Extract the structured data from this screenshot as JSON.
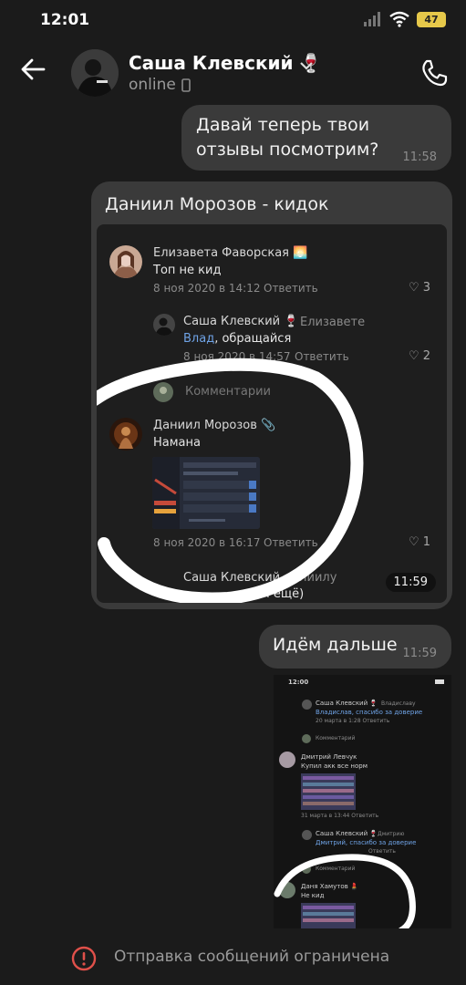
{
  "status": {
    "time": "12:01",
    "battery": "47"
  },
  "header": {
    "contact_name": "Саша Клевский 🍷",
    "status": "online"
  },
  "messages": {
    "m1": {
      "text": "Давай теперь твои отзывы посмотрим?",
      "time": "11:58"
    },
    "forward": {
      "title": "Даниил Морозов - кидок",
      "time": "11:59",
      "comments": [
        {
          "author": "Елизавета Фаворская 🌅",
          "text": "Топ не кид",
          "date": "8 ноя 2020 в 14:12",
          "reply": "Ответить",
          "likes": "3"
        },
        {
          "author": "Саша Клевский 🍷",
          "to": "Елизавете",
          "link": "Влад",
          "text": ", обращайся",
          "date": "8 ноя 2020 в 14:57",
          "reply": "Ответить",
          "likes": "2"
        },
        {
          "author": "Даниил Морозов 📎",
          "text": "Намана",
          "date": "8 ноя 2020 в 16:17",
          "reply": "Ответить",
          "likes": "1"
        }
      ],
      "comments_label": "Комментарии",
      "partial_author": "Саша Клевский",
      "partial_to": "ниилу",
      "partial_text": "лай ещё)"
    },
    "m2": {
      "text": "Идём дальше",
      "time": "11:59"
    },
    "screenshot": {
      "time": "12:00",
      "rows": [
        {
          "author": "Саша Клевский 🍷",
          "to": "Владиславу",
          "text": "Владислав, спасибо за доверие",
          "date": "20 марта в 1:28 Ответить"
        },
        {
          "author": "Комментарий"
        },
        {
          "author": "Дмитрий Левчук",
          "text": "Купил акк все норм",
          "date": "31 марта в 13:44 Ответить"
        },
        {
          "author": "Саша Клевский 🍷",
          "to": "Дмитрию",
          "text": "Дмитрий, спасибо за доверие",
          "date": "Ответить"
        },
        {
          "author": "Комментарий"
        },
        {
          "author": "Даня Хамутов 💄",
          "text": "Не кид"
        }
      ]
    }
  },
  "footer": {
    "restriction": "Отправка сообщений ограничена"
  }
}
